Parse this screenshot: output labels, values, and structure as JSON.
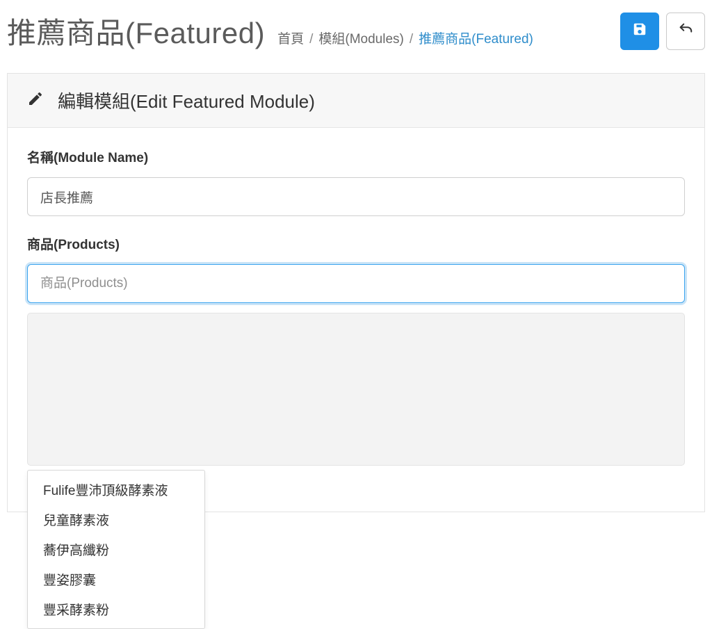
{
  "header": {
    "title": "推薦商品(Featured)",
    "breadcrumb": {
      "home": "首頁",
      "modules": "模組(Modules)",
      "current": "推薦商品(Featured)"
    }
  },
  "panel": {
    "heading": "編輯模組(Edit Featured Module)"
  },
  "form": {
    "name_label": "名稱(Module Name)",
    "name_value": "店長推薦",
    "products_label": "商品(Products)",
    "products_placeholder": "商品(Products)"
  },
  "dropdown": {
    "items": [
      "Fulife豐沛頂級酵素液",
      "兒童酵素液",
      "蕎伊高纖粉",
      "豐姿膠囊",
      "豐采酵素粉"
    ]
  }
}
